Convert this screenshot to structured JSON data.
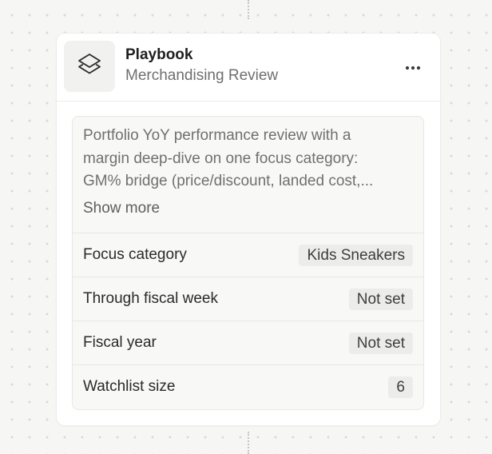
{
  "card": {
    "title": "Playbook",
    "subtitle": "Merchandising Review",
    "icon": "layers-icon",
    "menu_icon": "more-horizontal-icon"
  },
  "description": {
    "lines": [
      "Portfolio YoY performance review with a",
      "margin deep-dive on one focus category:",
      "GM% bridge (price/discount, landed cost,..."
    ],
    "show_more": "Show more"
  },
  "params": [
    {
      "label": "Focus category",
      "value": "Kids Sneakers"
    },
    {
      "label": "Through fiscal week",
      "value": "Not set"
    },
    {
      "label": "Fiscal year",
      "value": "Not set"
    },
    {
      "label": "Watchlist size",
      "value": "6"
    }
  ]
}
